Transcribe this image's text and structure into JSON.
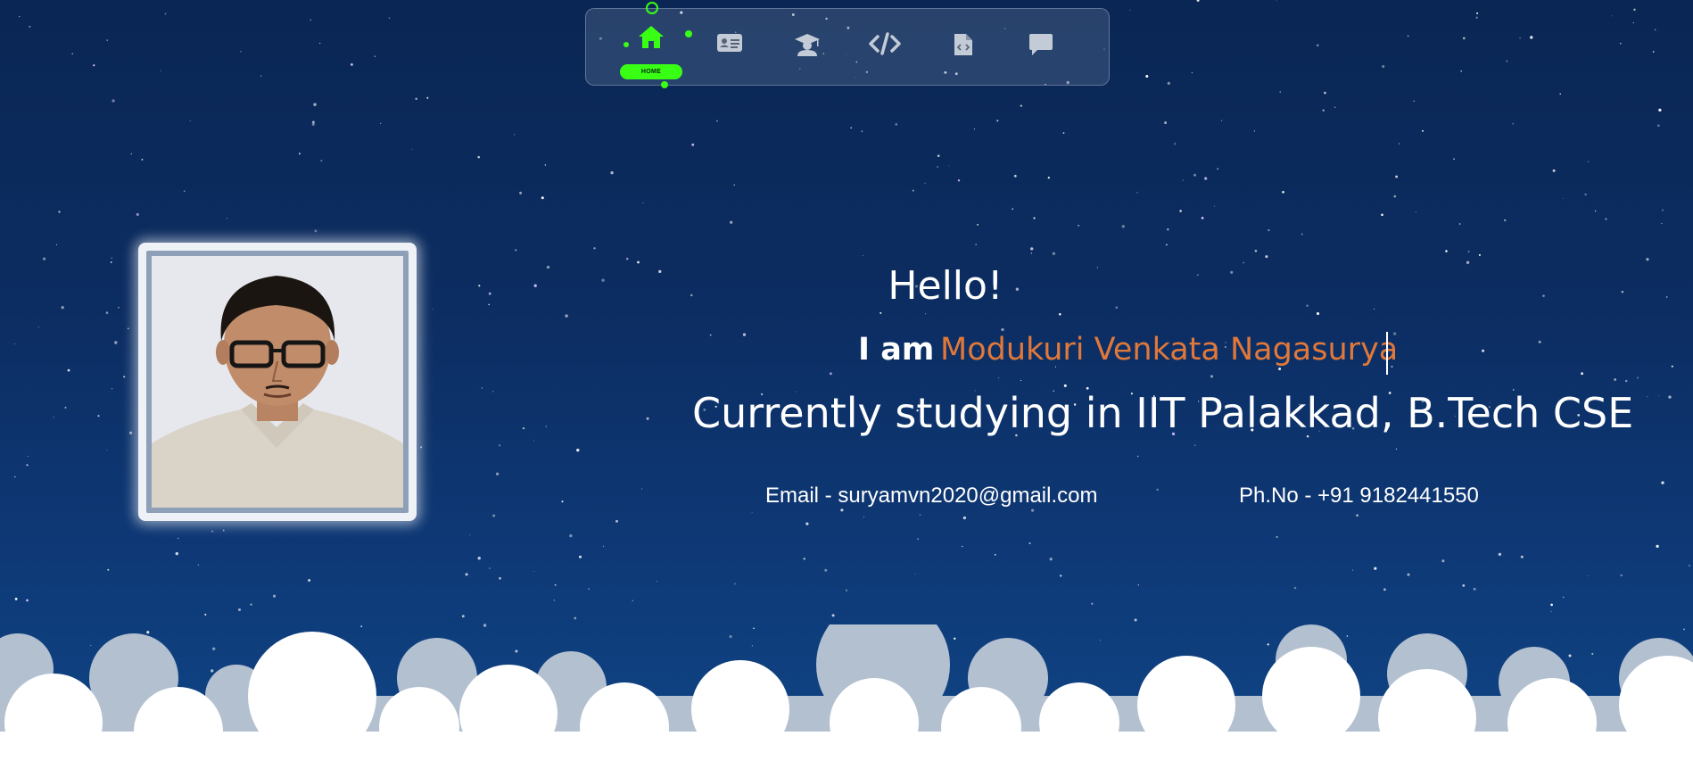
{
  "colors": {
    "background": "#0c2d62",
    "accent_green": "#39ff14",
    "name_orange": "#e0783a",
    "text": "#ffffff"
  },
  "nav": {
    "items": [
      {
        "icon": "home-icon",
        "label": "HOME",
        "active": true
      },
      {
        "icon": "id-card-icon",
        "active": false
      },
      {
        "icon": "graduation-icon",
        "active": false
      },
      {
        "icon": "code-icon",
        "active": false
      },
      {
        "icon": "file-code-icon",
        "active": false
      },
      {
        "icon": "chat-icon",
        "active": false
      }
    ]
  },
  "profile": {
    "photo": "profile-photo"
  },
  "hero": {
    "greeting": "Hello!",
    "iam": "I am",
    "name": "Modukuri Venkata Nagasurya",
    "studying": "Currently studying in IIT Palakkad, B.Tech CSE",
    "email": "Email - suryamvn2020@gmail.com",
    "phone": "Ph.No - +91 9182441550"
  }
}
